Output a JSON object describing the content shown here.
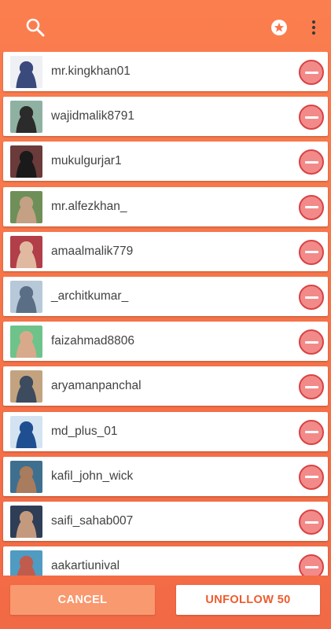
{
  "toolbar": {
    "search_icon": "search-icon",
    "favorite_icon": "star-circle-icon",
    "menu_icon": "more-vertical-icon"
  },
  "users": [
    {
      "username": "mr.kingkhan01",
      "avatar_colors": [
        "#eef0f4",
        "#3a4a7c"
      ]
    },
    {
      "username": "wajidmalik8791",
      "avatar_colors": [
        "#8fb1a2",
        "#2b2b2b"
      ]
    },
    {
      "username": "mukulgurjar1",
      "avatar_colors": [
        "#6b3a3a",
        "#1a1a1a"
      ]
    },
    {
      "username": "mr.alfezkhan_",
      "avatar_colors": [
        "#6f8f59",
        "#c4a084"
      ]
    },
    {
      "username": "amaalmalik779",
      "avatar_colors": [
        "#b13e48",
        "#e1b9a0"
      ]
    },
    {
      "username": "_architkumar_",
      "avatar_colors": [
        "#b7c9d8",
        "#5a6f86"
      ]
    },
    {
      "username": "faizahmad8806",
      "avatar_colors": [
        "#6ec38a",
        "#d9a98b"
      ]
    },
    {
      "username": "aryamanpanchal",
      "avatar_colors": [
        "#c3a37f",
        "#3d4b5f"
      ]
    },
    {
      "username": "md_plus_01",
      "avatar_colors": [
        "#d3e3f1",
        "#1f4f91"
      ]
    },
    {
      "username": "kafil_john_wick",
      "avatar_colors": [
        "#3f6f8f",
        "#a87c5c"
      ]
    },
    {
      "username": "saifi_sahab007",
      "avatar_colors": [
        "#2f3e57",
        "#c49a7e"
      ]
    },
    {
      "username": "aakartiunival",
      "avatar_colors": [
        "#4f9bc2",
        "#c05c4d"
      ]
    }
  ],
  "actions": {
    "cancel_label": "CANCEL",
    "unfollow_label": "UNFOLLOW 50"
  },
  "colors": {
    "accent": "#f7744a",
    "remove_fill": "#f38a8a",
    "remove_border": "#d84343",
    "unfollow_text": "#ef5a2c"
  }
}
